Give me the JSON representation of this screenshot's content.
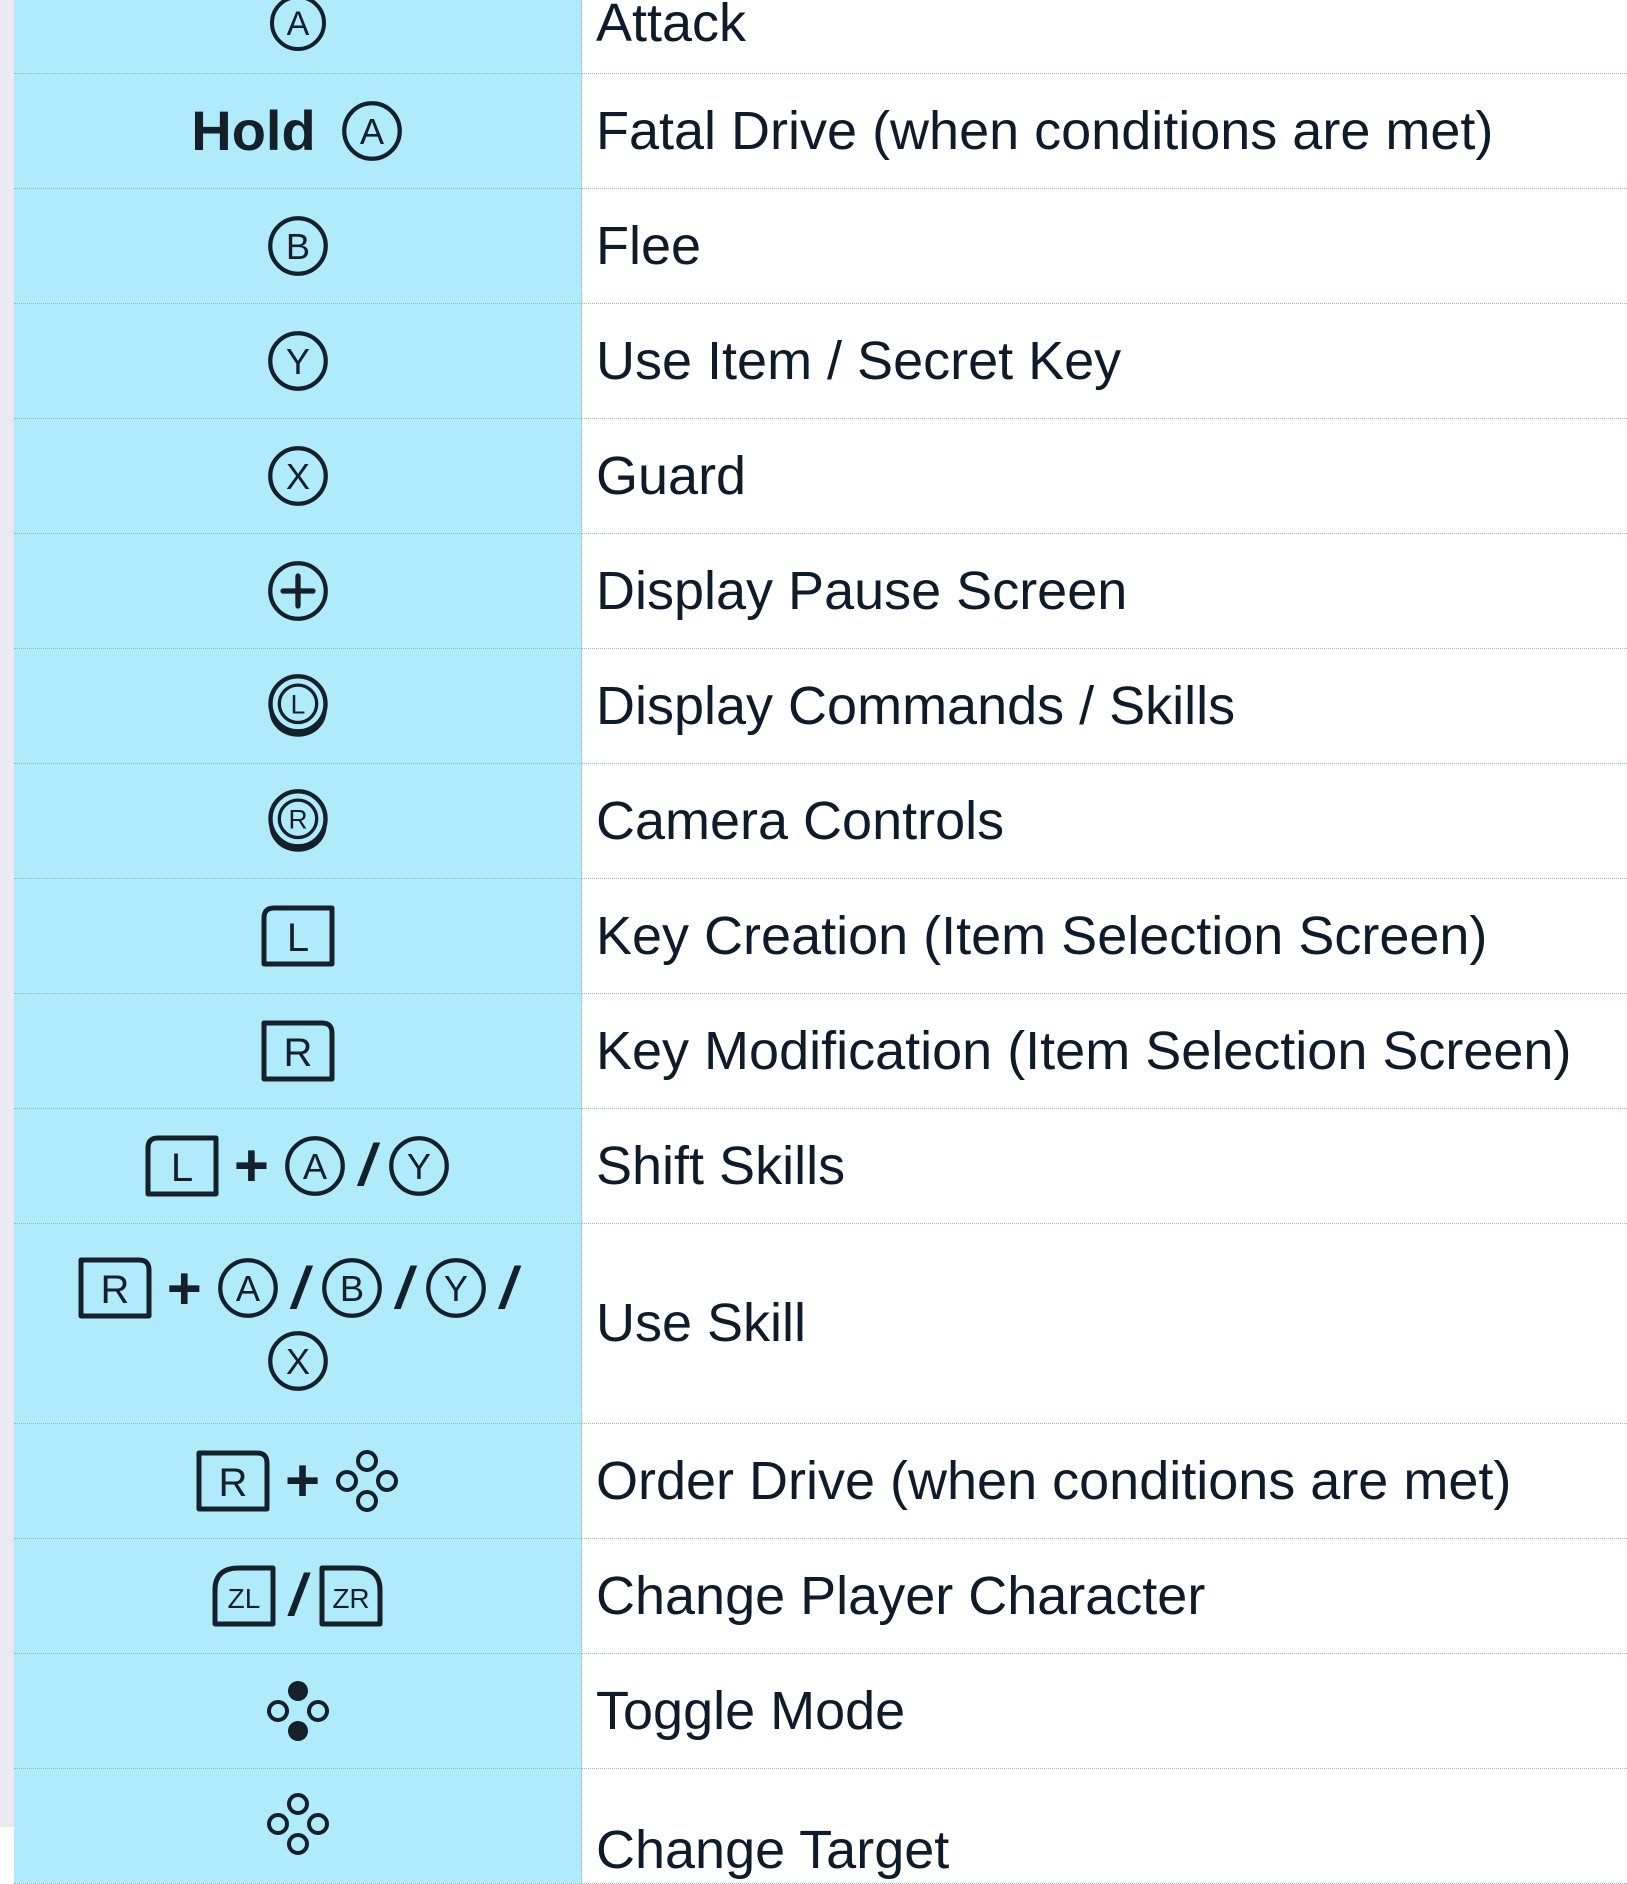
{
  "colors": {
    "button_column_bg": "#b0ebfb",
    "text": "#0d1b2a",
    "divider": "#8fb6c9"
  },
  "rows": [
    {
      "action": "Attack"
    },
    {
      "hold_label": "Hold",
      "action": "Fatal Drive (when conditions are met)"
    },
    {
      "action": "Flee"
    },
    {
      "action": "Use Item / Secret Key"
    },
    {
      "action": "Guard"
    },
    {
      "action": "Display Pause Screen"
    },
    {
      "action": "Display Commands / Skills"
    },
    {
      "action": "Camera Controls"
    },
    {
      "action": "Key Creation (Item Selection Screen)"
    },
    {
      "action": "Key Modification (Item Selection Screen)"
    },
    {
      "action": "Shift Skills"
    },
    {
      "action": "Use Skill"
    },
    {
      "action": "Order Drive (when conditions are met)"
    },
    {
      "action": "Change Player Character"
    },
    {
      "action": "Toggle Mode"
    },
    {
      "action": "Change Target"
    }
  ],
  "glyphs": {
    "A": "A",
    "B": "B",
    "Y": "Y",
    "X": "X",
    "L": "L",
    "R": "R",
    "ZL": "ZL",
    "ZR": "ZR",
    "plus": "+",
    "slash": "/"
  },
  "icons": {
    "a_button": "a-button-icon",
    "b_button": "b-button-icon",
    "y_button": "y-button-icon",
    "x_button": "x-button-icon",
    "plus_button": "plus-button-icon",
    "left_stick": "left-stick-icon",
    "right_stick": "right-stick-icon",
    "l_button": "l-button-icon",
    "r_button": "r-button-icon",
    "zl_button": "zl-button-icon",
    "zr_button": "zr-button-icon",
    "dpad": "dpad-icon",
    "dpad_left_right": "dpad-left-right-icon",
    "dpad_up": "dpad-up-icon"
  }
}
